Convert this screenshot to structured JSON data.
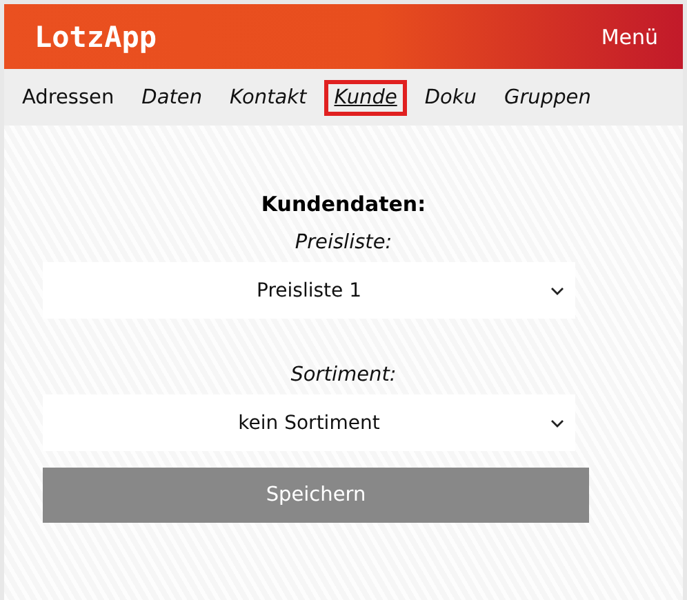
{
  "header": {
    "logo": "LotzApp",
    "menu": "Menü"
  },
  "tabs": [
    {
      "label": "Adressen",
      "kind": "plain",
      "selected": false
    },
    {
      "label": "Daten",
      "kind": "link",
      "selected": false
    },
    {
      "label": "Kontakt",
      "kind": "link",
      "selected": false
    },
    {
      "label": "Kunde",
      "kind": "link",
      "selected": true
    },
    {
      "label": "Doku",
      "kind": "link",
      "selected": false
    },
    {
      "label": "Gruppen",
      "kind": "link",
      "selected": false
    }
  ],
  "form": {
    "title": "Kundendaten:",
    "fields": [
      {
        "label": "Preisliste:",
        "value": "Preisliste 1"
      },
      {
        "label": "Sortiment:",
        "value": "kein Sortiment"
      }
    ],
    "button": "Speichern"
  }
}
